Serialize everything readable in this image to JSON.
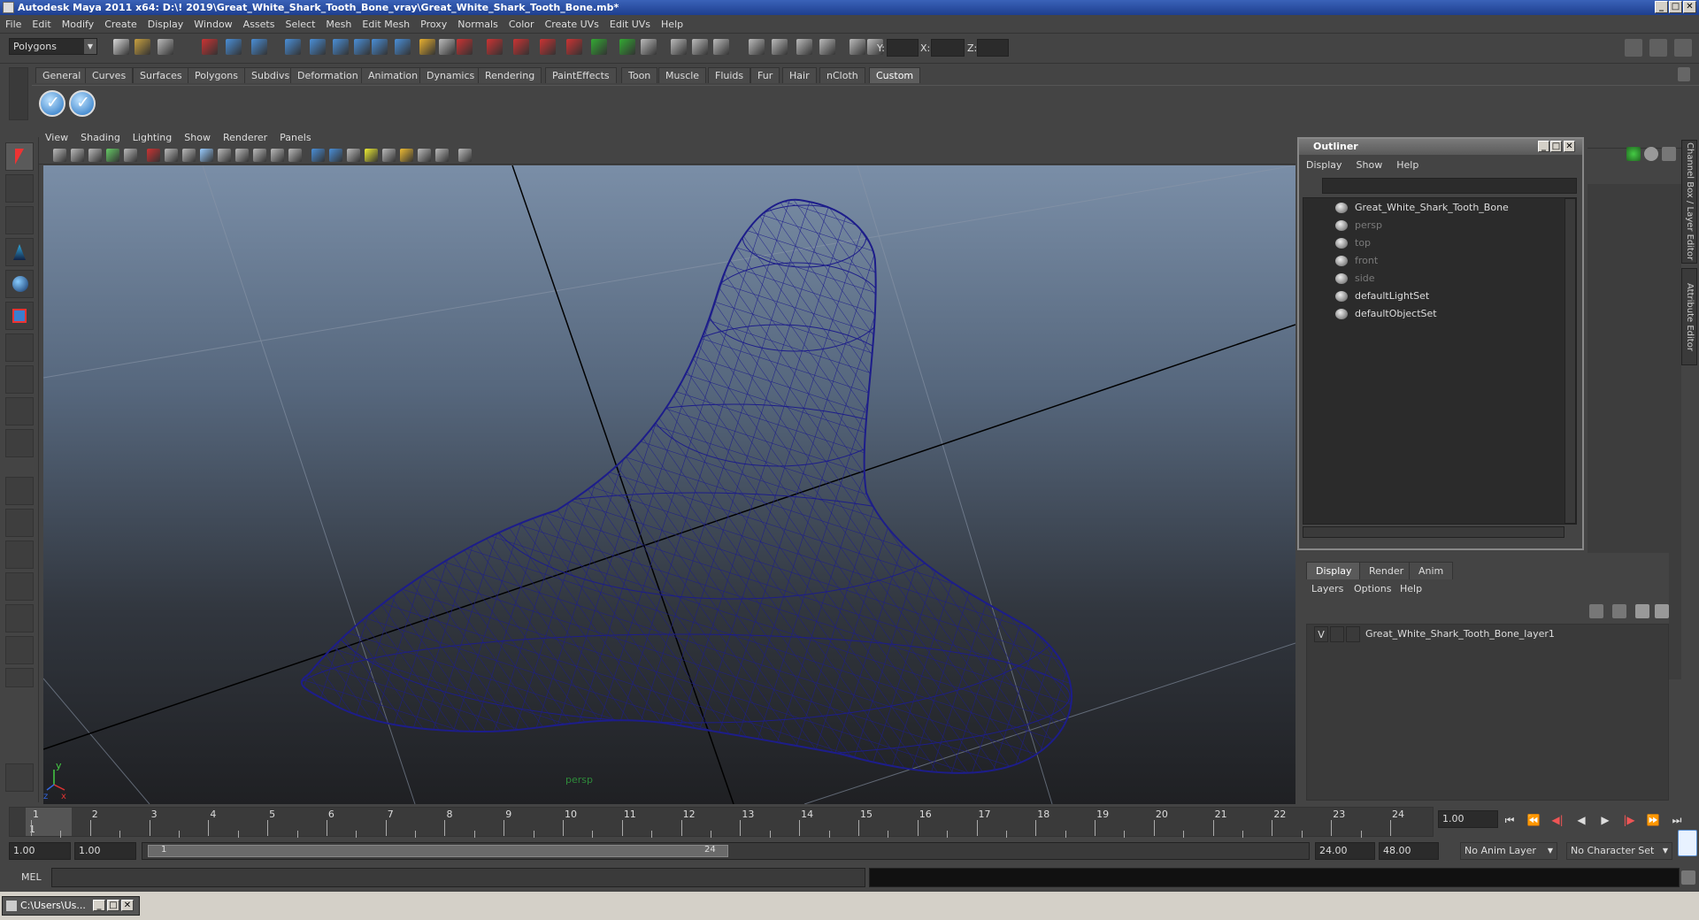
{
  "title": "Autodesk Maya 2011 x64: D:\\! 2019\\Great_White_Shark_Tooth_Bone_vray\\Great_White_Shark_Tooth_Bone.mb*",
  "window_buttons": {
    "minimize": "_",
    "maximize": "□",
    "close": "✕"
  },
  "menu": [
    "File",
    "Edit",
    "Modify",
    "Create",
    "Display",
    "Window",
    "Assets",
    "Select",
    "Mesh",
    "Edit Mesh",
    "Proxy",
    "Normals",
    "Color",
    "Create UVs",
    "Edit UVs",
    "Help"
  ],
  "status": {
    "mode": "Polygons",
    "x_label": "X:",
    "y_label": "Y:",
    "z_label": "Z:"
  },
  "shelf_tabs": [
    "General",
    "Curves",
    "Surfaces",
    "Polygons",
    "Subdivs",
    "Deformation",
    "Animation",
    "Dynamics",
    "Rendering",
    "PaintEffects",
    "Toon",
    "Muscle",
    "Fluids",
    "Fur",
    "Hair",
    "nCloth",
    "Custom"
  ],
  "active_shelf_tab": "Custom",
  "viewport": {
    "menu": [
      "View",
      "Shading",
      "Lighting",
      "Show",
      "Renderer",
      "Panels"
    ],
    "camera_label": "persp",
    "axis_y": "y",
    "axis_x": "x",
    "axis_z": "z",
    "mesh_color": "#1d1d8a"
  },
  "outliner": {
    "title": "Outliner",
    "menu": [
      "Display",
      "Show",
      "Help"
    ],
    "items": [
      {
        "label": "Great_White_Shark_Tooth_Bone",
        "dim": false
      },
      {
        "label": "persp",
        "dim": true
      },
      {
        "label": "top",
        "dim": true
      },
      {
        "label": "front",
        "dim": true
      },
      {
        "label": "side",
        "dim": true
      },
      {
        "label": "defaultLightSet",
        "dim": false
      },
      {
        "label": "defaultObjectSet",
        "dim": false
      }
    ]
  },
  "side_tabs": {
    "channel_box": "Channel Box / Layer Editor",
    "attribute_editor": "Attribute Editor"
  },
  "layer_editor": {
    "tabs": [
      "Display",
      "Render",
      "Anim"
    ],
    "active_tab": "Display",
    "menu": [
      "Layers",
      "Options",
      "Help"
    ],
    "layer": {
      "visible": "V",
      "name": "Great_White_Shark_Tooth_Bone_layer1"
    }
  },
  "timeline": {
    "ticks": [
      "1",
      "2",
      "3",
      "4",
      "5",
      "6",
      "7",
      "8",
      "9",
      "10",
      "11",
      "12",
      "13",
      "14",
      "15",
      "16",
      "17",
      "18",
      "19",
      "20",
      "21",
      "22",
      "23",
      "24"
    ],
    "current_frame": "1.00",
    "current_marker": "1"
  },
  "range": {
    "start": "1.00",
    "playback_start": "1.00",
    "slider_start": "1",
    "slider_end": "24",
    "playback_end": "24.00",
    "end": "48.00",
    "anim_layer": "No Anim Layer",
    "character_set": "No Character Set"
  },
  "cmdline": {
    "label": "MEL"
  },
  "taskbar": {
    "item": "C:\\Users\\Us..."
  }
}
